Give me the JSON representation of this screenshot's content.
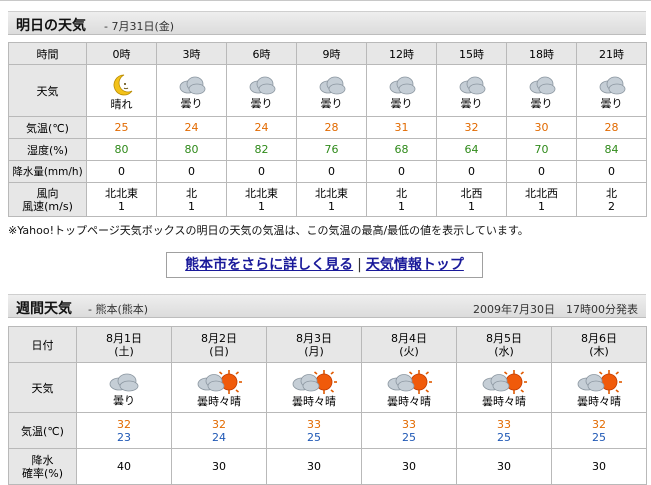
{
  "tomorrow": {
    "title": "明日の天気",
    "date": "- 7月31日(金)",
    "time_label": "時間",
    "weather_label": "天気",
    "temp_label": "気温(℃)",
    "humidity_label": "湿度(%)",
    "precip_label": "降水量(mm/h)",
    "wind_dir_label": "風向",
    "wind_speed_label": "風速(m/s)",
    "hours": [
      {
        "time": "0時",
        "icon": "moon-icon",
        "weather": "晴れ",
        "temp": "25",
        "humidity": "80",
        "precip": "0",
        "wind_dir": "北北東",
        "wind_speed": "1"
      },
      {
        "time": "3時",
        "icon": "cloud-icon",
        "weather": "曇り",
        "temp": "24",
        "humidity": "80",
        "precip": "0",
        "wind_dir": "北",
        "wind_speed": "1"
      },
      {
        "time": "6時",
        "icon": "cloud-icon",
        "weather": "曇り",
        "temp": "24",
        "humidity": "82",
        "precip": "0",
        "wind_dir": "北北東",
        "wind_speed": "1"
      },
      {
        "time": "9時",
        "icon": "cloud-icon",
        "weather": "曇り",
        "temp": "28",
        "humidity": "76",
        "precip": "0",
        "wind_dir": "北北東",
        "wind_speed": "1"
      },
      {
        "time": "12時",
        "icon": "cloud-icon",
        "weather": "曇り",
        "temp": "31",
        "humidity": "68",
        "precip": "0",
        "wind_dir": "北",
        "wind_speed": "1"
      },
      {
        "time": "15時",
        "icon": "cloud-icon",
        "weather": "曇り",
        "temp": "32",
        "humidity": "64",
        "precip": "0",
        "wind_dir": "北西",
        "wind_speed": "1"
      },
      {
        "time": "18時",
        "icon": "cloud-icon",
        "weather": "曇り",
        "temp": "30",
        "humidity": "70",
        "precip": "0",
        "wind_dir": "北北西",
        "wind_speed": "1"
      },
      {
        "time": "21時",
        "icon": "cloud-icon",
        "weather": "曇り",
        "temp": "28",
        "humidity": "84",
        "precip": "0",
        "wind_dir": "北",
        "wind_speed": "2"
      }
    ]
  },
  "note": "※Yahoo!トップページ天気ボックスの明日の天気の気温は、この気温の最高/最低の値を表示しています。",
  "links": {
    "city_detail": "熊本市をさらに詳しく見る",
    "separator": "|",
    "weather_top": "天気情報トップ"
  },
  "weekly": {
    "title": "週間天気",
    "region": "- 熊本(熊本)",
    "published": "2009年7月30日　17時00分発表",
    "date_label": "日付",
    "weather_label": "天気",
    "temp_label": "気温(℃)",
    "precip_label_1": "降水",
    "precip_label_2": "確率(%)",
    "days": [
      {
        "date": "8月1日",
        "dow": "(土)",
        "icon": "cloud-icon",
        "weather": "曇り",
        "high": "32",
        "low": "23",
        "precip": "40"
      },
      {
        "date": "8月2日",
        "dow": "(日)",
        "icon": "cloud-sun-icon",
        "weather": "曇時々晴",
        "high": "32",
        "low": "24",
        "precip": "30"
      },
      {
        "date": "8月3日",
        "dow": "(月)",
        "icon": "cloud-sun-icon",
        "weather": "曇時々晴",
        "high": "33",
        "low": "25",
        "precip": "30"
      },
      {
        "date": "8月4日",
        "dow": "(火)",
        "icon": "cloud-sun-icon",
        "weather": "曇時々晴",
        "high": "33",
        "low": "25",
        "precip": "30"
      },
      {
        "date": "8月5日",
        "dow": "(水)",
        "icon": "cloud-sun-icon",
        "weather": "曇時々晴",
        "high": "33",
        "low": "25",
        "precip": "30"
      },
      {
        "date": "8月6日",
        "dow": "(木)",
        "icon": "cloud-sun-icon",
        "weather": "曇時々晴",
        "high": "32",
        "low": "25",
        "precip": "30"
      }
    ]
  }
}
